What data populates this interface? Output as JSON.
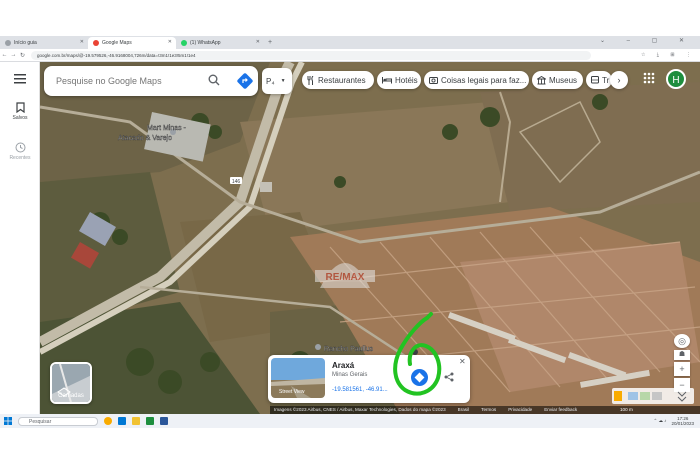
{
  "browser": {
    "tabs": [
      {
        "label": "Início guia",
        "active": false,
        "favicon_color": "#9aa0a6"
      },
      {
        "label": "Google Maps",
        "active": true,
        "favicon_color": "#ea4335"
      },
      {
        "label": "(1) WhatsApp",
        "active": false,
        "favicon_color": "#25d366"
      }
    ],
    "new_tab": "+",
    "url": "google.com.br/maps/@-19.579526,-46.9168004,726m/data=!3m1!1e3!5m1!1e4"
  },
  "maps": {
    "search_placeholder": "Pesquise no Google Maps",
    "sidebar": {
      "menu_icon": "hamburger-icon",
      "saved_label": "Salvos",
      "recent_label": "Recentes"
    },
    "map_type_short": "P₄",
    "chips": [
      {
        "label": "Restaurantes",
        "icon": "fork-knife-icon"
      },
      {
        "label": "Hotéis",
        "icon": "bed-icon"
      },
      {
        "label": "Coisas legais para faz...",
        "icon": "camera-icon"
      },
      {
        "label": "Museus",
        "icon": "museum-icon"
      },
      {
        "label": "Tr",
        "icon": "transit-icon"
      }
    ],
    "avatar_initial": "H",
    "map_labels": {
      "store": "Mart Minas - Atacado & Varejo",
      "road": "146",
      "place": "Rancho Paullus"
    },
    "watermark": "RE/MAX",
    "layers_label": "Camadas",
    "place_card": {
      "name": "Araxá",
      "subtitle": "Minas Gerais",
      "coords": "-19.581561, -46.91...",
      "street_view_label": "Street View"
    },
    "attribution": {
      "imagery": "Imagens ©2023 Airbus, CNES / Airbus, Maxar Technologies, Dados do mapa ©2023",
      "links": [
        "Brasil",
        "Termos",
        "Privacidade",
        "Enviar feedback"
      ],
      "scale": "100 m"
    }
  },
  "taskbar": {
    "search_placeholder": "Pesquisar",
    "time": "17:26",
    "date": "20/01/2023"
  },
  "colors": {
    "accent": "#1a73e8",
    "scribble": "#22c322",
    "avatar": "#1e8e3e"
  }
}
